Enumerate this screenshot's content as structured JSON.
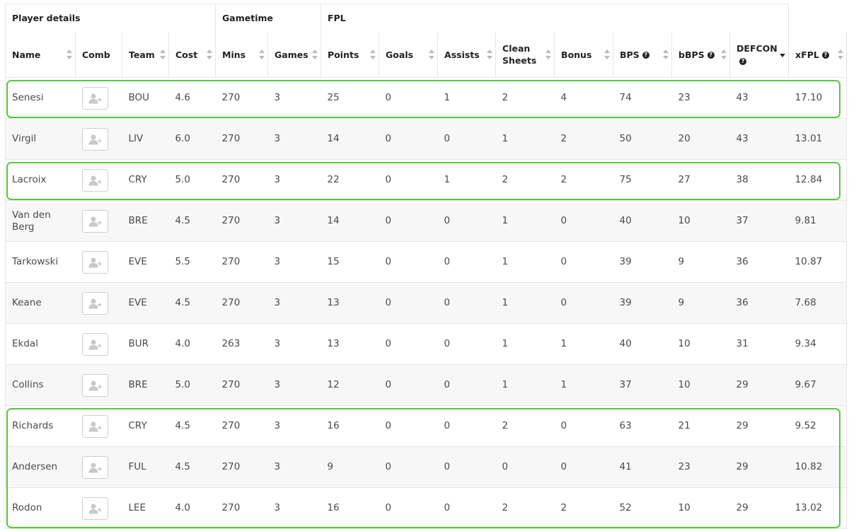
{
  "groups": [
    {
      "label": "Player details",
      "span": 4
    },
    {
      "label": "Gametime",
      "span": 2
    },
    {
      "label": "FPL",
      "span": 8
    }
  ],
  "columns": [
    {
      "key": "name",
      "label": "Name",
      "help": false,
      "sort": "none"
    },
    {
      "key": "comb",
      "label": "Comb",
      "help": false,
      "sort": "hidden"
    },
    {
      "key": "team",
      "label": "Team",
      "help": false,
      "sort": "none"
    },
    {
      "key": "cost",
      "label": "Cost",
      "help": false,
      "sort": "none"
    },
    {
      "key": "mins",
      "label": "Mins",
      "help": false,
      "sort": "none"
    },
    {
      "key": "games",
      "label": "Games",
      "help": false,
      "sort": "none"
    },
    {
      "key": "points",
      "label": "Points",
      "help": false,
      "sort": "none"
    },
    {
      "key": "goals",
      "label": "Goals",
      "help": false,
      "sort": "none"
    },
    {
      "key": "assists",
      "label": "Assists",
      "help": false,
      "sort": "none"
    },
    {
      "key": "clean_sheets",
      "label": "Clean Sheets",
      "help": false,
      "sort": "none"
    },
    {
      "key": "bonus",
      "label": "Bonus",
      "help": false,
      "sort": "none"
    },
    {
      "key": "bps",
      "label": "BPS",
      "help": true,
      "sort": "none"
    },
    {
      "key": "bbps",
      "label": "bBPS",
      "help": true,
      "sort": "none"
    },
    {
      "key": "defcon",
      "label": "DEFCON",
      "help": true,
      "sort": "desc"
    },
    {
      "key": "xfpl",
      "label": "xFPL",
      "help": true,
      "sort": "none"
    }
  ],
  "rows": [
    {
      "name": "Senesi",
      "team": "BOU",
      "cost": "4.6",
      "mins": "270",
      "games": "3",
      "points": "25",
      "goals": "0",
      "assists": "1",
      "clean_sheets": "2",
      "bonus": "4",
      "bps": "74",
      "bbps": "23",
      "defcon": "43",
      "xfpl": "17.10",
      "highlighted": true
    },
    {
      "name": "Virgil",
      "team": "LIV",
      "cost": "6.0",
      "mins": "270",
      "games": "3",
      "points": "14",
      "goals": "0",
      "assists": "0",
      "clean_sheets": "1",
      "bonus": "2",
      "bps": "50",
      "bbps": "20",
      "defcon": "43",
      "xfpl": "13.01",
      "highlighted": false
    },
    {
      "name": "Lacroix",
      "team": "CRY",
      "cost": "5.0",
      "mins": "270",
      "games": "3",
      "points": "22",
      "goals": "0",
      "assists": "1",
      "clean_sheets": "2",
      "bonus": "2",
      "bps": "75",
      "bbps": "27",
      "defcon": "38",
      "xfpl": "12.84",
      "highlighted": true
    },
    {
      "name": "Van den Berg",
      "team": "BRE",
      "cost": "4.5",
      "mins": "270",
      "games": "3",
      "points": "14",
      "goals": "0",
      "assists": "0",
      "clean_sheets": "1",
      "bonus": "0",
      "bps": "40",
      "bbps": "10",
      "defcon": "37",
      "xfpl": "9.81",
      "highlighted": false
    },
    {
      "name": "Tarkowski",
      "team": "EVE",
      "cost": "5.5",
      "mins": "270",
      "games": "3",
      "points": "15",
      "goals": "0",
      "assists": "0",
      "clean_sheets": "1",
      "bonus": "0",
      "bps": "39",
      "bbps": "9",
      "defcon": "36",
      "xfpl": "10.87",
      "highlighted": false
    },
    {
      "name": "Keane",
      "team": "EVE",
      "cost": "4.5",
      "mins": "270",
      "games": "3",
      "points": "13",
      "goals": "0",
      "assists": "0",
      "clean_sheets": "1",
      "bonus": "0",
      "bps": "39",
      "bbps": "9",
      "defcon": "36",
      "xfpl": "7.68",
      "highlighted": false
    },
    {
      "name": "Ekdal",
      "team": "BUR",
      "cost": "4.0",
      "mins": "263",
      "games": "3",
      "points": "13",
      "goals": "0",
      "assists": "0",
      "clean_sheets": "1",
      "bonus": "1",
      "bps": "40",
      "bbps": "10",
      "defcon": "31",
      "xfpl": "9.34",
      "highlighted": false
    },
    {
      "name": "Collins",
      "team": "BRE",
      "cost": "5.0",
      "mins": "270",
      "games": "3",
      "points": "12",
      "goals": "0",
      "assists": "0",
      "clean_sheets": "1",
      "bonus": "1",
      "bps": "37",
      "bbps": "10",
      "defcon": "29",
      "xfpl": "9.67",
      "highlighted": false
    },
    {
      "name": "Richards",
      "team": "CRY",
      "cost": "4.5",
      "mins": "270",
      "games": "3",
      "points": "16",
      "goals": "0",
      "assists": "0",
      "clean_sheets": "2",
      "bonus": "0",
      "bps": "63",
      "bbps": "21",
      "defcon": "29",
      "xfpl": "9.52",
      "highlighted": true
    },
    {
      "name": "Andersen",
      "team": "FUL",
      "cost": "4.5",
      "mins": "270",
      "games": "3",
      "points": "9",
      "goals": "0",
      "assists": "0",
      "clean_sheets": "0",
      "bonus": "0",
      "bps": "41",
      "bbps": "23",
      "defcon": "29",
      "xfpl": "10.82",
      "highlighted": true
    },
    {
      "name": "Rodon",
      "team": "LEE",
      "cost": "4.0",
      "mins": "270",
      "games": "3",
      "points": "16",
      "goals": "0",
      "assists": "0",
      "clean_sheets": "2",
      "bonus": "2",
      "bps": "52",
      "bbps": "10",
      "defcon": "29",
      "xfpl": "13.02",
      "highlighted": true
    }
  ],
  "comb_icon": "add-user-icon",
  "highlight_color": "#56c83e",
  "help_icon": "question-circle-icon"
}
